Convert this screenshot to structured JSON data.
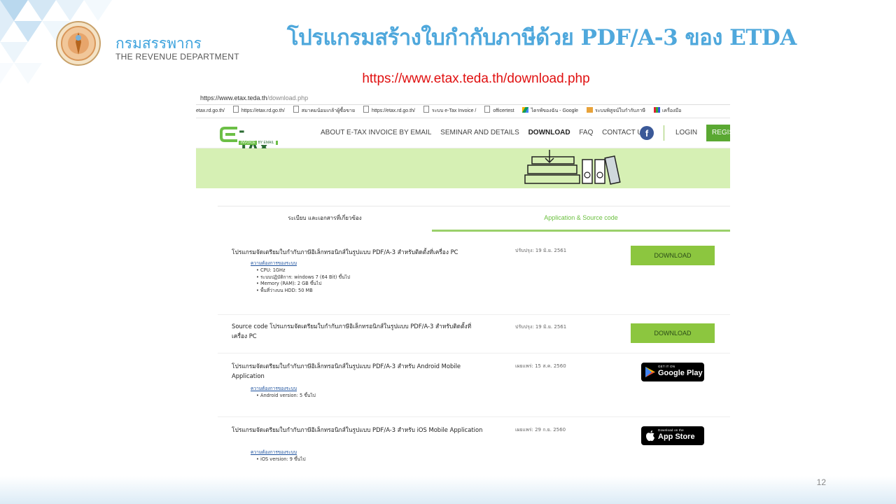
{
  "slide": {
    "title": "โปรแกรมสร้างใบกำกับภาษีด้วย PDF/A-3 ของ ETDA",
    "url": "https://www.etax.teda.th/download.php",
    "org_name_th": "กรมสรรพากร",
    "org_name_en": "THE REVENUE DEPARTMENT",
    "page_number": "12",
    "title_color": "#4fa8dc",
    "url_color": "#e01010"
  },
  "browser": {
    "address_host": "https://www.etax.teda.th",
    "address_path": "/download.php",
    "bookmarks": [
      {
        "icon": "page-icon",
        "label": "etax.rd.go.th/"
      },
      {
        "icon": "page-icon",
        "label": "https://etax.rd.go.th/"
      },
      {
        "icon": "page-icon",
        "label": "สมาคมน้อมเกล้าผู้ซื้อขาย"
      },
      {
        "icon": "page-icon",
        "label": "https://etax.rd.go.th/"
      },
      {
        "icon": "page-icon",
        "label": "ระบบ e-Tax Invoice /"
      },
      {
        "icon": "page-icon",
        "label": "officertest"
      },
      {
        "icon": "drive-icon",
        "label": "ไดรฟ์ของฉัน - Google"
      },
      {
        "icon": "folder-icon",
        "label": "ระบบพิสูจน์ใบกำกับภาษี"
      },
      {
        "icon": "multicolor-icon",
        "label": "เครื่องมือ"
      }
    ]
  },
  "site": {
    "logo_text": "-TAX",
    "logo_sub": "INVOICE",
    "logo_sub2": "BY EMAIL",
    "nav": [
      "ABOUT E-TAX INVOICE BY EMAIL",
      "SEMINAR AND DETAILS",
      "DOWNLOAD",
      "FAQ",
      "CONTACT US"
    ],
    "facebook_label": "f",
    "login": "LOGIN",
    "register": "REGIS",
    "accent_color": "#8cc63f"
  },
  "tabs": {
    "regulations": "ระเบียบ และเอกสารที่เกี่ยวข้อง",
    "apps": "Application & Source code"
  },
  "rows": [
    {
      "title": "โปรแกรมจัดเตรียมใบกำกับภาษีอิเล็กทรอนิกส์ในรูปแบบ PDF/A-3 สำหรับติดตั้งที่เครื่อง PC",
      "date": "ปรับปรุง: 19 มิ.ย. 2561",
      "req_header": "ความต้องการของระบบ",
      "requirements": [
        "• CPU: 1GHz",
        "• ระบบปฏิบัติการ: windows 7 (64 Bit) ขึ้นไป",
        "• Memory (RAM): 2 GB ขึ้นไป",
        "• พื้นที่ว่างบน HDD: 50 MB"
      ],
      "button": "DOWNLOAD"
    },
    {
      "title": "Source code โปรแกรมจัดเตรียมใบกำกับภาษีอิเล็กทรอนิกส์ในรูปแบบ PDF/A-3 สำหรับติดตั้งที่เครื่อง PC",
      "date": "ปรับปรุง: 19 มิ.ย. 2561",
      "button": "DOWNLOAD"
    },
    {
      "title": "โปรแกรมจัดเตรียมใบกำกับภาษีอิเล็กทรอนิกส์ในรูปแบบ PDF/A-3 สำหรับ Android Mobile Application",
      "date": "เผยแพร่: 15 ส.ค. 2560",
      "req_header": "ความต้องการของระบบ",
      "requirements": [
        "• Android version: 5 ขึ้นไป"
      ],
      "store_small": "GET IT ON",
      "store_big": "Google Play"
    },
    {
      "title": "โปรแกรมจัดเตรียมใบกำกับภาษีอิเล็กทรอนิกส์ในรูปแบบ PDF/A-3 สำหรับ iOS Mobile Application",
      "date": "เผยแพร่: 29 ก.ย. 2560",
      "req_header": "ความต้องการของระบบ",
      "requirements": [
        "• iOS version: 9 ขึ้นไป"
      ],
      "store_small": "Download on the",
      "store_big": "App Store"
    }
  ]
}
